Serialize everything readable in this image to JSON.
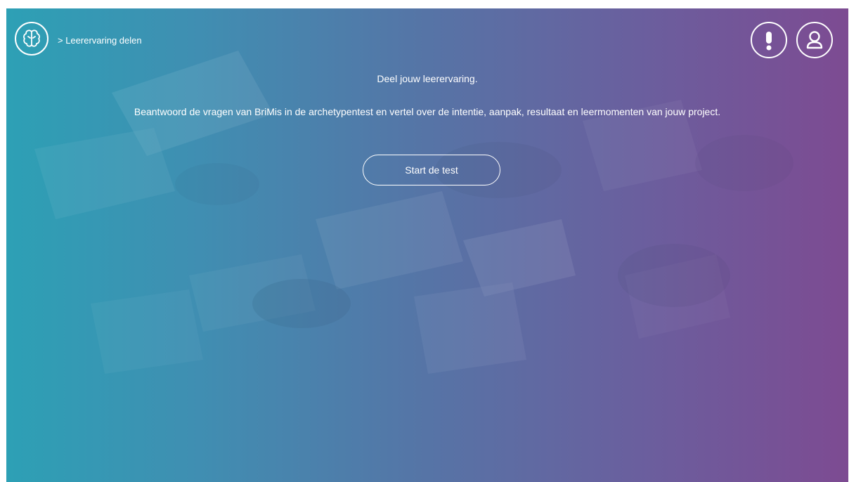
{
  "breadcrumb": {
    "label": "> Leerervaring delen"
  },
  "main": {
    "title": "Deel jouw leerervaring.",
    "description": "Beantwoord de vragen van BriMis in de archetypentest en vertel over de intentie, aanpak, resultaat en leermomenten van jouw project.",
    "start_button_label": "Start de test"
  },
  "icons": {
    "logo": "brain-icon",
    "alert": "exclamation-icon",
    "profile": "user-icon"
  },
  "colors": {
    "gradient_start": "#2da0b5",
    "gradient_end": "#7d4b92",
    "foreground": "#ffffff"
  }
}
